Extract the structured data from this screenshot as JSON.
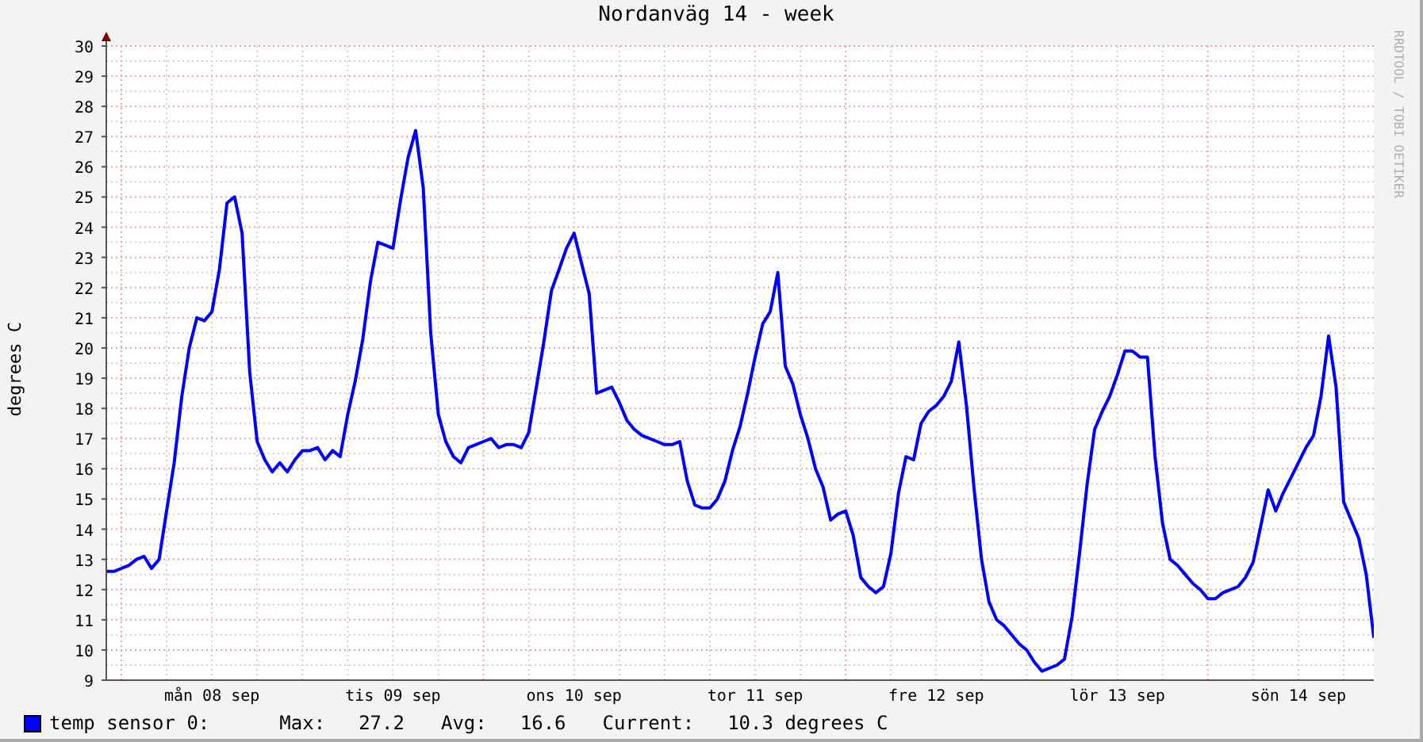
{
  "graph": {
    "title": "Nordanväg 14 - week",
    "credit": "RRDTOOL / TOBI OETIKER",
    "chart_data": {
      "type": "line",
      "grid": true,
      "ylabel": "degrees C",
      "ylim": [
        9,
        30
      ],
      "yticks": [
        9,
        10,
        11,
        12,
        13,
        14,
        15,
        16,
        17,
        18,
        19,
        20,
        21,
        22,
        23,
        24,
        25,
        26,
        27,
        28,
        29,
        30
      ],
      "categories": [
        null,
        null,
        null,
        null,
        null,
        null,
        null,
        null,
        null,
        null,
        null,
        null,
        null,
        null,
        "mån 08 sep",
        null,
        null,
        null,
        null,
        null,
        null,
        null,
        null,
        null,
        null,
        null,
        null,
        null,
        null,
        null,
        null,
        null,
        null,
        null,
        null,
        null,
        null,
        null,
        "tis 09 sep",
        null,
        null,
        null,
        null,
        null,
        null,
        null,
        null,
        null,
        null,
        null,
        null,
        null,
        null,
        null,
        null,
        null,
        null,
        null,
        null,
        null,
        null,
        null,
        "ons 10 sep",
        null,
        null,
        null,
        null,
        null,
        null,
        null,
        null,
        null,
        null,
        null,
        null,
        null,
        null,
        null,
        null,
        null,
        null,
        null,
        null,
        null,
        null,
        null,
        "tor 11 sep",
        null,
        null,
        null,
        null,
        null,
        null,
        null,
        null,
        null,
        null,
        null,
        null,
        null,
        null,
        null,
        null,
        null,
        null,
        null,
        null,
        null,
        null,
        null,
        "fre 12 sep",
        null,
        null,
        null,
        null,
        null,
        null,
        null,
        null,
        null,
        null,
        null,
        null,
        null,
        null,
        null,
        null,
        null,
        null,
        null,
        null,
        null,
        null,
        null,
        "lör 13 sep",
        null,
        null,
        null,
        null,
        null,
        null,
        null,
        null,
        null,
        null,
        null,
        null,
        null,
        null,
        null,
        null,
        null,
        null,
        null,
        null,
        null,
        null,
        null,
        "sön 14 sep",
        null,
        null,
        null,
        null,
        null,
        null,
        null,
        null,
        null,
        null
      ],
      "series": [
        {
          "name": "temp sensor 0:",
          "color": "#0000ff",
          "values": [
            12.6,
            12.6,
            12.7,
            12.8,
            13.0,
            13.1,
            12.7,
            13.0,
            14.6,
            16.2,
            18.4,
            20.0,
            21.0,
            20.9,
            21.2,
            22.6,
            24.8,
            25.0,
            23.8,
            19.2,
            16.9,
            16.3,
            15.9,
            16.2,
            15.9,
            16.3,
            16.6,
            16.6,
            16.7,
            16.3,
            16.6,
            16.4,
            17.8,
            18.9,
            20.3,
            22.2,
            23.5,
            23.4,
            23.3,
            24.9,
            26.3,
            27.2,
            25.3,
            20.5,
            17.8,
            16.9,
            16.4,
            16.2,
            16.7,
            16.8,
            16.9,
            17.0,
            16.7,
            16.8,
            16.8,
            16.7,
            17.2,
            18.7,
            20.2,
            21.9,
            22.6,
            23.3,
            23.8,
            22.8,
            21.8,
            18.5,
            18.6,
            18.7,
            18.2,
            17.6,
            17.3,
            17.1,
            17.0,
            16.9,
            16.8,
            16.8,
            16.9,
            15.6,
            14.8,
            14.7,
            14.7,
            15.0,
            15.6,
            16.6,
            17.4,
            18.5,
            19.7,
            20.8,
            21.2,
            22.5,
            19.4,
            18.8,
            17.8,
            17.0,
            16.0,
            15.4,
            14.3,
            14.5,
            14.6,
            13.8,
            12.4,
            12.1,
            11.9,
            12.1,
            13.2,
            15.2,
            16.4,
            16.3,
            17.5,
            17.9,
            18.1,
            18.4,
            18.9,
            20.2,
            18.1,
            15.4,
            13.0,
            11.6,
            11.0,
            10.8,
            10.5,
            10.2,
            10.0,
            9.6,
            9.3,
            9.4,
            9.5,
            9.7,
            11.1,
            13.2,
            15.5,
            17.3,
            17.9,
            18.4,
            19.1,
            19.9,
            19.9,
            19.7,
            19.7,
            16.4,
            14.2,
            13.0,
            12.8,
            12.5,
            12.2,
            12.0,
            11.7,
            11.7,
            11.9,
            12.0,
            12.1,
            12.4,
            12.9,
            14.1,
            15.3,
            14.6,
            15.2,
            15.7,
            16.2,
            16.7,
            17.1,
            18.4,
            20.4,
            18.7,
            14.9,
            14.3,
            13.7,
            12.5,
            10.4
          ]
        }
      ]
    },
    "legend": {
      "stats": [
        {
          "label": "Max:",
          "value": "27.2"
        },
        {
          "label": "Avg:",
          "value": "16.6"
        },
        {
          "label": "Current:",
          "value": "10.3 degrees C"
        }
      ]
    }
  }
}
